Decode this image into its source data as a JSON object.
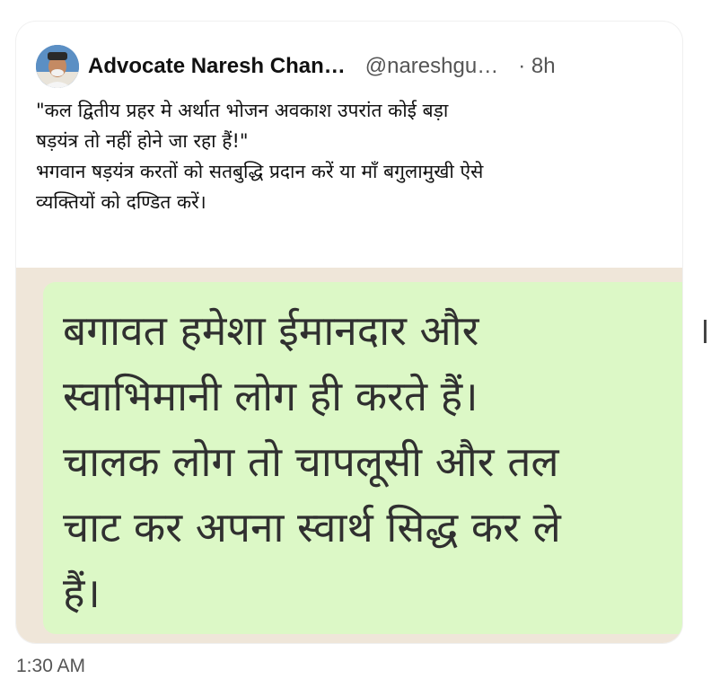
{
  "post": {
    "author_name": "Advocate Naresh Chan…",
    "handle": "@nareshgu…",
    "time": "· 8h",
    "text_lines": [
      "\"कल द्वितीय प्रहर मे  अर्थात भोजन अवकाश उपरांत कोई बड़ा",
      "षड़यंत्र तो नहीं होने जा रहा हैं!\"",
      "भगवान षड़यंत्र करतों को सतबुद्धि प्रदान करें या माँ बगुलामुखी ऐसे",
      "व्यक्तियों को दण्डित करें।"
    ]
  },
  "image": {
    "message_lines": [
      "बगावत हमेशा ईमानदार और",
      "स्वाभिमानी लोग ही करते हैं।",
      "चालक लोग तो चापलूसी और तल",
      "चाट कर अपना स्वार्थ सिद्ध कर ले",
      "हैं।"
    ]
  },
  "footer": {
    "time": "1:30 AM"
  },
  "colors": {
    "bubble": "#dcf8c6",
    "chat_bg": "#efe6d9"
  },
  "icons": {
    "avatar": "profile-avatar"
  }
}
